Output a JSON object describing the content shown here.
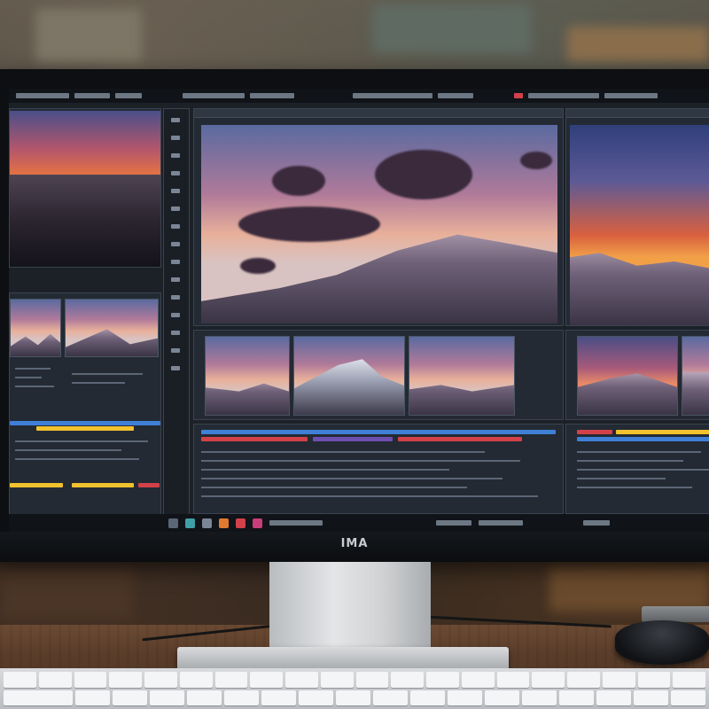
{
  "monitor": {
    "brand_label": "IMA"
  },
  "icons": {
    "topbar_close": "record-icon",
    "taskbar": [
      "app-icon",
      "app-icon",
      "app-icon",
      "app-icon",
      "app-icon",
      "app-icon"
    ]
  },
  "colors": {
    "ui_background": "#1c2128",
    "accent_yellow": "#f2c12e",
    "accent_red": "#d2414a",
    "accent_blue": "#3f7fd6",
    "sunset_orange": "#f07e36"
  }
}
